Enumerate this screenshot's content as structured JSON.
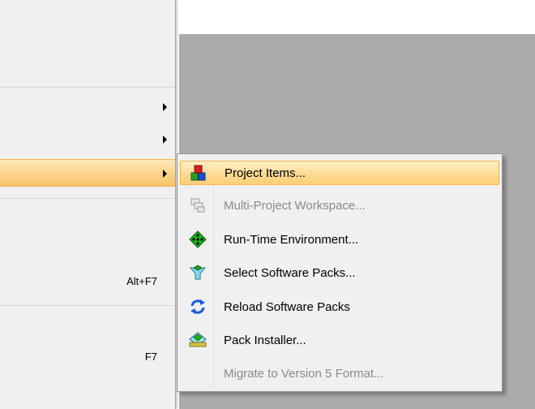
{
  "parent_menu": {
    "shortcuts": [
      "Alt+F7",
      "F7"
    ]
  },
  "submenu": {
    "items": [
      {
        "label": "Project Items...",
        "icon": "project-items-icon",
        "state": "selected"
      },
      {
        "label": "Multi-Project Workspace...",
        "icon": "multi-project-workspace-icon",
        "state": "disabled"
      },
      {
        "label": "Run-Time Environment...",
        "icon": "run-time-environment-icon",
        "state": "enabled"
      },
      {
        "label": "Select Software Packs...",
        "icon": "select-software-packs-icon",
        "state": "enabled"
      },
      {
        "label": "Reload Software Packs",
        "icon": "reload-icon",
        "state": "enabled"
      },
      {
        "label": "Pack Installer...",
        "icon": "pack-installer-icon",
        "state": "enabled"
      },
      {
        "label": "Migrate to Version 5 Format...",
        "icon": "",
        "state": "disabled"
      }
    ]
  },
  "colors": {
    "highlight": "#fbd38a",
    "highlight_border": "#f1b54a",
    "workspace": "#ababab",
    "menu_bg": "#f0f0f0",
    "disabled_text": "#8a8a8a"
  }
}
